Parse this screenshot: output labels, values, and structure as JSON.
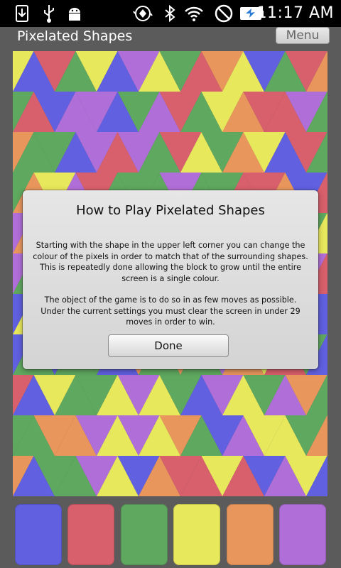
{
  "status_bar": {
    "time": "11:17 AM",
    "icons": [
      "download-icon",
      "usb-icon",
      "android-debug-icon",
      "rotate-icon",
      "bluetooth-icon",
      "wifi-icon",
      "no-signal-icon",
      "battery-charging-icon"
    ]
  },
  "app": {
    "title": "Pixelated Shapes",
    "menu_label": "Menu"
  },
  "colors": {
    "blue": "#6060e0",
    "red": "#d85f6c",
    "green": "#5fa85f",
    "yellow": "#e8e85c",
    "orange": "#e9965c",
    "purple": "#b06ed8",
    "background": "#5b5b5b"
  },
  "board": {
    "rows": 11,
    "triangles_per_row": 15,
    "palette_order": [
      "blue",
      "red",
      "green",
      "yellow",
      "orange",
      "purple"
    ]
  },
  "dialog": {
    "title": "How to Play Pixelated Shapes",
    "paragraph1": "Starting with the shape in the upper left corner you can change the colour of the pixels in order to match that of the surrounding shapes. This is repeatedly done allowing the block to grow until the entire screen is a single colour.",
    "paragraph2": "The object of the game is to do so in as few moves as possible. Under the current settings you must clear the screen in under 29 moves in order to win.",
    "done_label": "Done"
  }
}
